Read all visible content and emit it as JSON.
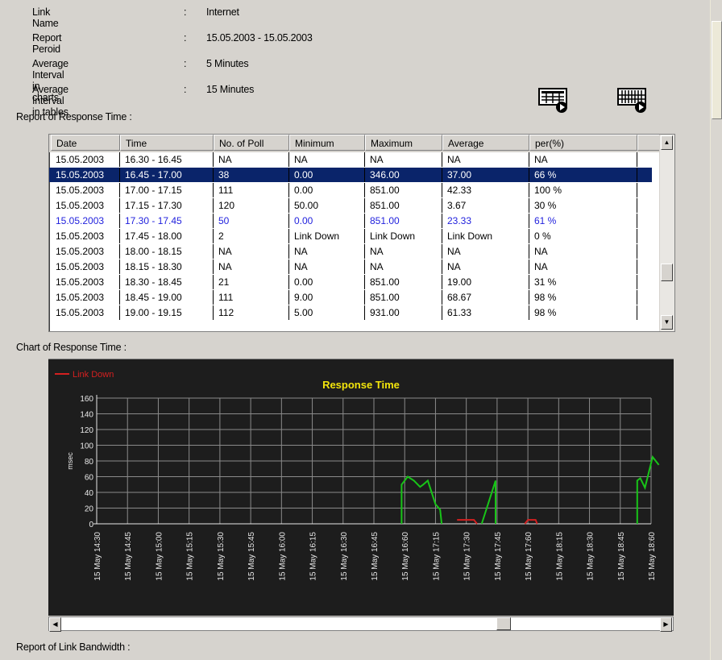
{
  "info": {
    "link_name_label": "Link Name",
    "link_name_value": "Internet",
    "report_period_label": "Report Peroid",
    "report_period_value": "15.05.2003 - 15.05.2003",
    "avg_chart_label": "Average Interval in charts",
    "avg_chart_value": "5 Minutes",
    "avg_table_label": "Average Interval in tables",
    "avg_table_value": "15 Minutes",
    "colon": ":"
  },
  "sections": {
    "response_table_title": "Report of Response Time :",
    "response_chart_title": "Chart of Response Time :",
    "bandwidth_title": "Report of Link Bandwidth :"
  },
  "table": {
    "columns": [
      "Date",
      "Time",
      "No. of Poll",
      "Minimum",
      "Maximum",
      "Average",
      "per(%)"
    ],
    "rows": [
      [
        "15.05.2003",
        "16.30 - 16.45",
        "NA",
        "NA",
        "NA",
        "NA",
        "NA"
      ],
      [
        "15.05.2003",
        "16.45 - 17.00",
        "38",
        "0.00",
        "346.00",
        "37.00",
        "66 %"
      ],
      [
        "15.05.2003",
        "17.00 - 17.15",
        "111",
        "0.00",
        "851.00",
        "42.33",
        "100 %"
      ],
      [
        "15.05.2003",
        "17.15 - 17.30",
        "120",
        "50.00",
        "851.00",
        "3.67",
        "30 %"
      ],
      [
        "15.05.2003",
        "17.30 - 17.45",
        "50",
        "0.00",
        "851.00",
        "23.33",
        "61 %"
      ],
      [
        "15.05.2003",
        "17.45 - 18.00",
        "2",
        "Link Down",
        "Link Down",
        "Link Down",
        "0 %"
      ],
      [
        "15.05.2003",
        "18.00 - 18.15",
        "NA",
        "NA",
        "NA",
        "NA",
        "NA"
      ],
      [
        "15.05.2003",
        "18.15 - 18.30",
        "NA",
        "NA",
        "NA",
        "NA",
        "NA"
      ],
      [
        "15.05.2003",
        "18.30 - 18.45",
        "21",
        "0.00",
        "851.00",
        "19.00",
        "31 %"
      ],
      [
        "15.05.2003",
        "18.45 - 19.00",
        "111",
        "9.00",
        "851.00",
        "68.67",
        "98 %"
      ],
      [
        "15.05.2003",
        "19.00 - 19.15",
        "112",
        "5.00",
        "931.00",
        "61.33",
        "98 %"
      ]
    ],
    "selected_row": 1,
    "highlighted_row": 4
  },
  "chart_data": {
    "type": "line",
    "title": "Response Time",
    "legend": [
      "Link Down"
    ],
    "legend_position": "top-left",
    "ylabel": "msec",
    "ylim": [
      0,
      160
    ],
    "yticks": [
      0,
      20,
      40,
      60,
      80,
      100,
      120,
      140,
      160
    ],
    "grid": true,
    "x": [
      "15 May 14:30",
      "15 May 14:45",
      "15 May 15:00",
      "15 May 15:15",
      "15 May 15:30",
      "15 May 15:45",
      "15 May 16:00",
      "15 May 16:15",
      "15 May 16:30",
      "15 May 16:45",
      "15 May 16:60",
      "15 May 17:15",
      "15 May 17:30",
      "15 May 17:45",
      "15 May 17:60",
      "15 May 18:15",
      "15 May 18:30",
      "15 May 18:45",
      "15 May 18:60"
    ],
    "series": [
      {
        "color": "#18c418",
        "segments": [
          [
            [
              9.9,
              0
            ],
            [
              9.9,
              50
            ],
            [
              10.1,
              60
            ],
            [
              10.3,
              55
            ],
            [
              10.5,
              47
            ],
            [
              10.6,
              50
            ],
            [
              10.75,
              55
            ],
            [
              11.0,
              25
            ],
            [
              11.15,
              18
            ],
            [
              11.2,
              0
            ]
          ],
          [
            [
              12.5,
              0
            ],
            [
              12.95,
              55
            ],
            [
              12.95,
              0
            ]
          ],
          [
            [
              17.55,
              0
            ],
            [
              17.55,
              55
            ],
            [
              17.65,
              58
            ],
            [
              17.8,
              46
            ],
            [
              18.05,
              85
            ],
            [
              18.25,
              75
            ]
          ]
        ]
      },
      {
        "name": "Link Down",
        "color": "#d42020",
        "segments": [
          [
            [
              11.7,
              5
            ],
            [
              12.25,
              5
            ],
            [
              12.35,
              0
            ]
          ],
          [
            [
              13.9,
              0
            ],
            [
              14.0,
              5
            ],
            [
              14.25,
              5
            ],
            [
              14.3,
              0
            ]
          ]
        ]
      }
    ]
  },
  "colors": {
    "chart_background": "#1d1d1d",
    "grid": "#8a8a8a",
    "title": "#f2e40c",
    "axis_text": "#e8e8e8",
    "selected_row": "#0a246a",
    "highlight_text": "#1f1fdd"
  },
  "icons": {
    "export_chart": "export-chart-icon",
    "export_table": "export-table-icon"
  }
}
